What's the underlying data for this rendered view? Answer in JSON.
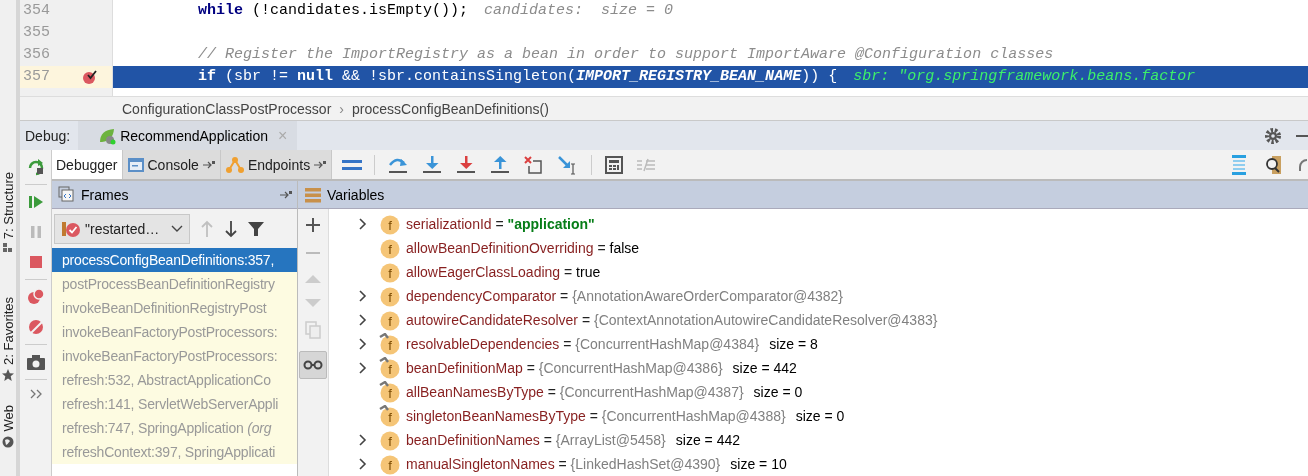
{
  "side_tabs": [
    {
      "label": "7: Structure"
    },
    {
      "label": "2: Favorites"
    },
    {
      "label": "Web"
    }
  ],
  "editor": {
    "lines": [
      {
        "number": "354",
        "current": false,
        "breakpoint": false,
        "tokens": [
          {
            "kind": "keyword",
            "text": "while"
          },
          {
            "kind": "plain",
            "text": " (!candidates.isEmpty());"
          },
          {
            "kind": "hint",
            "text": "candidates:  size = 0"
          }
        ]
      },
      {
        "number": "355",
        "current": false,
        "breakpoint": false
      },
      {
        "number": "356",
        "current": false,
        "breakpoint": false,
        "tokens": [
          {
            "kind": "comment",
            "text": "// Register the ImportRegistry as a bean in order to support ImportAware @Configuration classes"
          }
        ]
      },
      {
        "number": "357",
        "current": true,
        "breakpoint": true,
        "tokens": [
          {
            "kind": "keyword",
            "text": "if"
          },
          {
            "kind": "plain",
            "text": " (sbr != "
          },
          {
            "kind": "keyword",
            "text": "null"
          },
          {
            "kind": "plain",
            "text": " && !sbr.containsSingleton("
          },
          {
            "kind": "constant",
            "text": "IMPORT_REGISTRY_BEAN_NAME"
          },
          {
            "kind": "plain",
            "text": ")) {"
          },
          {
            "kind": "hint",
            "text": "sbr: \"org.springframework.beans.factor"
          }
        ]
      }
    ],
    "breadcrumb": {
      "items": [
        "ConfigurationClassPostProcessor",
        "processConfigBeanDefinitions()"
      ],
      "separator": "›"
    }
  },
  "debug": {
    "label": "Debug:",
    "session": {
      "title": "RecommendApplication",
      "close": "×"
    },
    "tabs": [
      {
        "label": "Debugger",
        "selected": true
      },
      {
        "label": "Console",
        "selected": false
      },
      {
        "label": "Endpoints",
        "selected": false
      }
    ],
    "frames": {
      "title": "Frames",
      "thread": "\"restarted…",
      "items": [
        {
          "text": "processConfigBeanDefinitions:357,",
          "selected": true
        },
        {
          "text": "postProcessBeanDefinitionRegistry",
          "selected": false
        },
        {
          "text": "invokeBeanDefinitionRegistryPost",
          "selected": false
        },
        {
          "text": "invokeBeanFactoryPostProcessors:",
          "selected": false
        },
        {
          "text": "invokeBeanFactoryPostProcessors:",
          "selected": false
        },
        {
          "text": "refresh:532, AbstractApplicationCo",
          "selected": false
        },
        {
          "text": "refresh:141, ServletWebServerAppli",
          "selected": false
        },
        {
          "text": "refresh:747, SpringApplication *(org*",
          "selected": false
        },
        {
          "text": "refreshContext:397, SpringApplicati",
          "selected": false
        }
      ]
    },
    "variables": {
      "title": "Variables",
      "inline_watches_on": true,
      "rows": [
        {
          "kind": "string",
          "expandable": true,
          "final": false,
          "icon_letter": "f",
          "name": "serializationId",
          "operator": "=",
          "value": "\"application\""
        },
        {
          "kind": "plain",
          "expandable": false,
          "final": false,
          "icon_letter": "f",
          "name": "allowBeanDefinitionOverriding",
          "operator": "=",
          "value": "false"
        },
        {
          "kind": "plain",
          "expandable": false,
          "final": false,
          "icon_letter": "f",
          "name": "allowEagerClassLoading",
          "operator": "=",
          "value": "true"
        },
        {
          "kind": "object",
          "expandable": true,
          "final": false,
          "icon_letter": "f",
          "name": "dependencyComparator",
          "operator": "=",
          "value": "{AnnotationAwareOrderComparator@4382}"
        },
        {
          "kind": "object",
          "expandable": true,
          "final": false,
          "icon_letter": "f",
          "name": "autowireCandidateResolver",
          "operator": "=",
          "value": "{ContextAnnotationAutowireCandidateResolver@4383}"
        },
        {
          "kind": "object",
          "expandable": true,
          "final": true,
          "icon_letter": "f",
          "name": "resolvableDependencies",
          "operator": "=",
          "value": "{ConcurrentHashMap@4384}",
          "size": "size = 8"
        },
        {
          "kind": "object",
          "expandable": true,
          "final": true,
          "icon_letter": "f",
          "name": "beanDefinitionMap",
          "operator": "=",
          "value": "{ConcurrentHashMap@4386}",
          "size": "size = 442"
        },
        {
          "kind": "object",
          "expandable": false,
          "final": true,
          "icon_letter": "f",
          "name": "allBeanNamesByType",
          "operator": "=",
          "value": "{ConcurrentHashMap@4387}",
          "size": "size = 0"
        },
        {
          "kind": "object",
          "expandable": false,
          "final": true,
          "icon_letter": "f",
          "name": "singletonBeanNamesByType",
          "operator": "=",
          "value": "{ConcurrentHashMap@4388}",
          "size": "size = 0"
        },
        {
          "kind": "object",
          "expandable": true,
          "final": false,
          "icon_letter": "f",
          "name": "beanDefinitionNames",
          "operator": "=",
          "value": "{ArrayList@5458}",
          "size": "size = 442"
        },
        {
          "kind": "object",
          "expandable": true,
          "final": false,
          "icon_letter": "f",
          "name": "manualSingletonNames",
          "operator": "=",
          "value": "{LinkedHashSet@4390}",
          "size": "size = 10"
        }
      ]
    }
  }
}
